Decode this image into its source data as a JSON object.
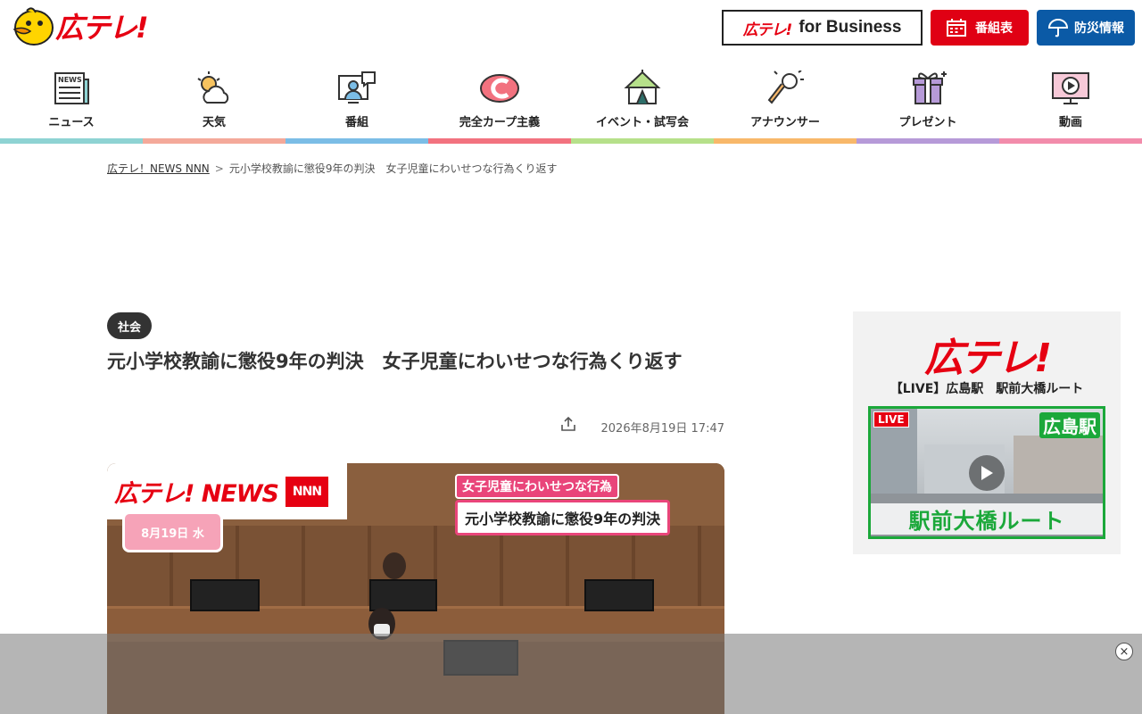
{
  "header": {
    "logo_text": "広テレ!",
    "business_button": {
      "logo": "広テレ!",
      "label": "for Business"
    },
    "schedule_button": {
      "label": "番組表",
      "icon": "calendar-icon"
    },
    "disaster_button": {
      "label": "防災情報",
      "icon": "umbrella-icon"
    }
  },
  "nav": {
    "items": [
      {
        "label": "ニュース",
        "icon": "newspaper-icon",
        "color": "#8ed3d3"
      },
      {
        "label": "天気",
        "icon": "weather-icon",
        "color": "#f4a99a"
      },
      {
        "label": "番組",
        "icon": "program-icon",
        "color": "#7bbde6"
      },
      {
        "label": "完全カープ主義",
        "icon": "carp-icon",
        "color": "#f2727f"
      },
      {
        "label": "イベント・試写会",
        "icon": "event-tent-icon",
        "color": "#b6e08a"
      },
      {
        "label": "アナウンサー",
        "icon": "microphone-icon",
        "color": "#f8b86a"
      },
      {
        "label": "プレゼント",
        "icon": "gift-icon",
        "color": "#b69ad8"
      },
      {
        "label": "動画",
        "icon": "video-icon",
        "color": "#f28cab"
      }
    ]
  },
  "breadcrumb": {
    "home": "広テレ！NEWS NNN",
    "separator": ">",
    "current": "元小学校教諭に懲役9年の判決　女子児童にわいせつな行為くり返す"
  },
  "article": {
    "category": "社会",
    "title": "元小学校教諭に懲役9年の判決　女子児童にわいせつな行為くり返す",
    "date": "2026年8月19日 17:47"
  },
  "video": {
    "logo": "広テレ! NEWS",
    "logo_nnn": "NNN",
    "date_badge": "8月19日 水",
    "caption_top": "女子児童にわいせつな行為",
    "caption_main": "元小学校教諭に懲役9年の判決"
  },
  "sidebar": {
    "logo": "広テレ!",
    "live_title": "【LIVE】広島駅　駅前大橋ルート",
    "live_tag": "LIVE",
    "station_label": "広島駅",
    "route_label": "駅前大橋ルート"
  },
  "ad": {
    "close_label": "×"
  }
}
